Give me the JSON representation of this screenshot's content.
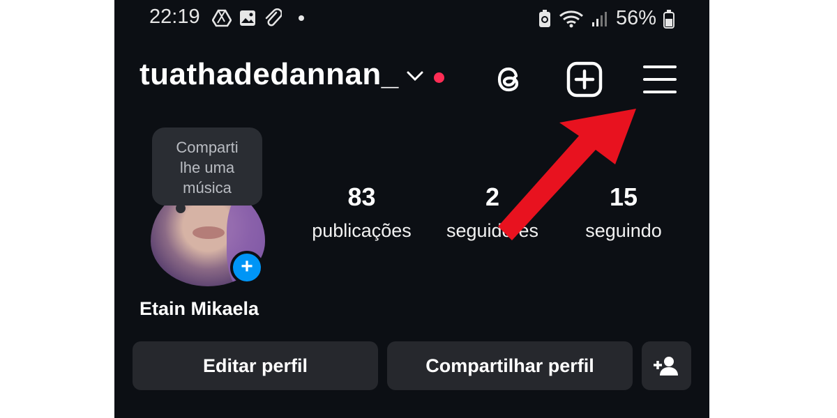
{
  "status_bar": {
    "time": "22:19",
    "battery": "56%"
  },
  "profile": {
    "username": "tuathadedannan_",
    "display_name": "Etain Mikaela",
    "note_tooltip": {
      "line1": "Comparti",
      "line2": "lhe uma",
      "line3": "música"
    }
  },
  "stats": [
    {
      "value": "83",
      "label": "publicações"
    },
    {
      "value": "2",
      "label": "seguidores"
    },
    {
      "value": "15",
      "label": "seguindo"
    }
  ],
  "buttons": {
    "edit": "Editar perfil",
    "share": "Compartilhar perfil"
  },
  "icons": {
    "threads": "threads-icon",
    "create": "plus-square-icon",
    "menu": "hamburger-menu-icon",
    "add_person": "add-person-icon",
    "annotation": "red-arrow-icon"
  },
  "colors": {
    "background": "#0c0f14",
    "button": "#26282d",
    "accent_blue": "#0095f6",
    "notification": "#ff2d55",
    "annotation_arrow": "#e8121f"
  }
}
